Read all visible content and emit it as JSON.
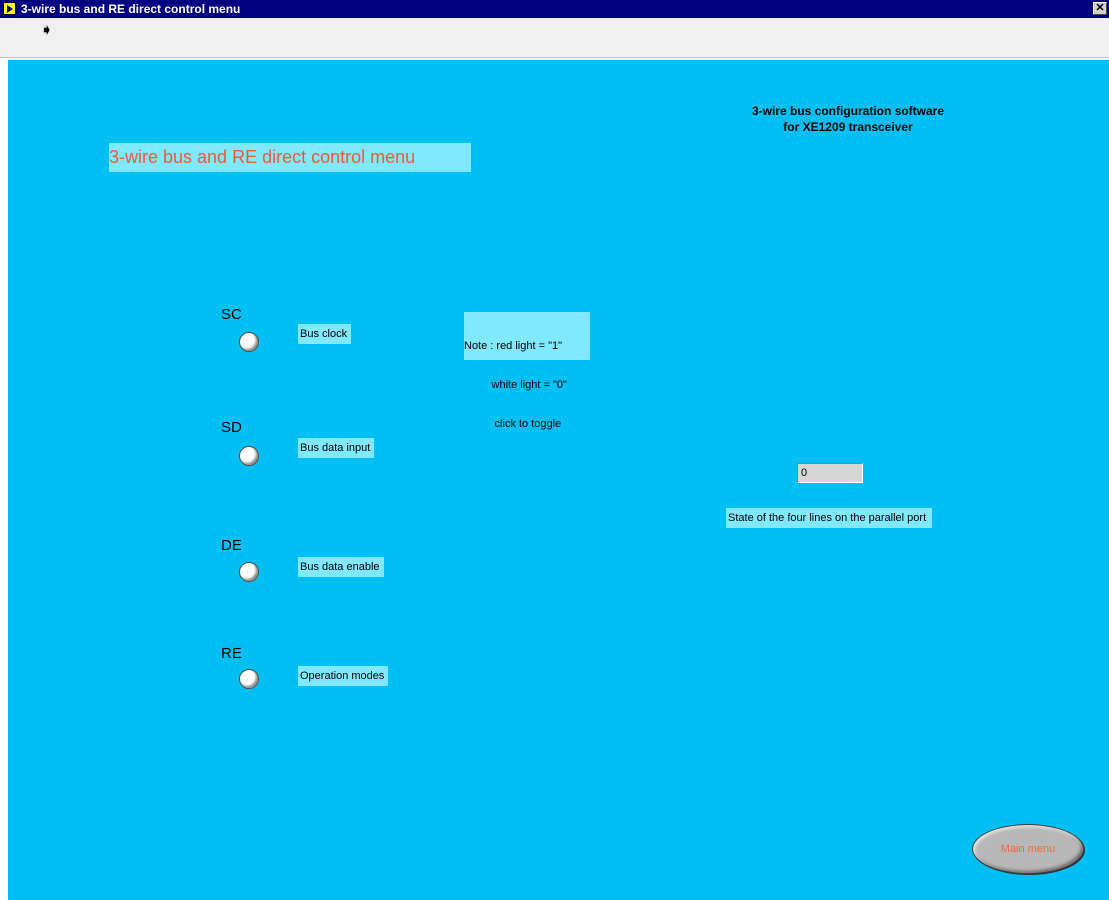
{
  "window": {
    "title": "3-wire bus and RE direct control menu",
    "close_glyph": "✕"
  },
  "toolbar": {
    "run_icon": "➧"
  },
  "panel": {
    "main_title": "3-wire bus and RE direct control menu",
    "app_title_line1": "3-wire bus configuration software",
    "app_title_line2": "for XE1209 transceiver",
    "note_line1": "Note : red light = \"1\"",
    "note_line2": "         white light = \"0\"",
    "note_line3": "          click to toggle",
    "lines": [
      {
        "name": "SC",
        "description": "Bus clock",
        "state": 0
      },
      {
        "name": "SD",
        "description": "Bus data input",
        "state": 0
      },
      {
        "name": "DE",
        "description": "Bus data enable",
        "state": 0
      },
      {
        "name": "RE",
        "description": "Operation modes",
        "state": 0
      }
    ],
    "port_value": "0",
    "port_label": "State of the four lines on the parallel port",
    "main_menu_label": "Main menu"
  },
  "colors": {
    "panel_bg": "#00bff3",
    "label_bg": "#80e8ff",
    "title_text": "#f05a3a",
    "led_off": "#ffffff",
    "led_on": "#ff0000"
  }
}
